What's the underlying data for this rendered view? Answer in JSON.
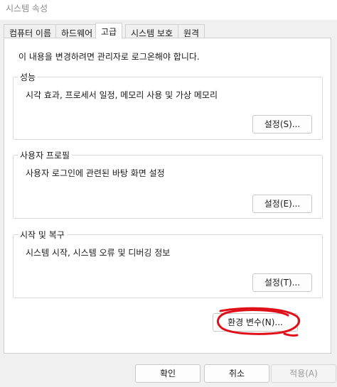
{
  "window": {
    "title": "시스템 속성"
  },
  "tabs": [
    {
      "label": "컴퓨터 이름"
    },
    {
      "label": "하드웨어"
    },
    {
      "label": "고급"
    },
    {
      "label": "시스템 보호"
    },
    {
      "label": "원격"
    }
  ],
  "active_tab": "고급",
  "notice": "이 내용을 변경하려면 관리자로 로그온해야 합니다.",
  "groups": {
    "performance": {
      "title": "성능",
      "description": "시각 효과, 프로세서 일정, 메모리 사용 및 가상 메모리",
      "button": "설정(S)..."
    },
    "user_profiles": {
      "title": "사용자 프로필",
      "description": "사용자 로그인에 관련된 바탕 화면 설정",
      "button": "설정(E)..."
    },
    "startup_recovery": {
      "title": "시작 및 복구",
      "description": "시스템 시작, 시스템 오류 및 디버깅 정보",
      "button": "설정(T)..."
    }
  },
  "env_button": "환경 변수(N)...",
  "footer": {
    "ok": "확인",
    "cancel": "취소",
    "apply": "적용(A)"
  },
  "annotation": {
    "color": "#e0101a",
    "shape": "hand-drawn circle around environment variables button"
  }
}
